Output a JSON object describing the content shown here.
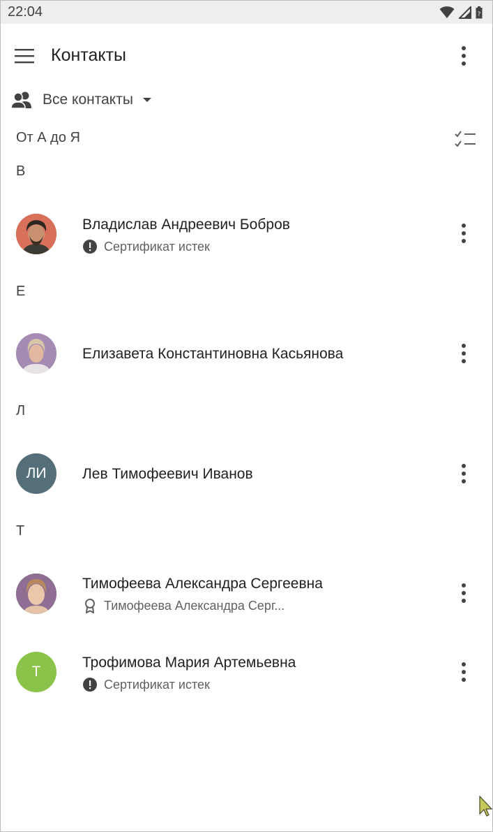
{
  "status_bar": {
    "time": "22:04",
    "icons": [
      "wifi-icon",
      "signal-icon",
      "battery-icon"
    ]
  },
  "app_bar": {
    "title": "Контакты",
    "menu_icon": "hamburger-icon",
    "overflow_icon": "more-vert-icon"
  },
  "filter": {
    "label": "Все контакты",
    "icon": "people-icon",
    "dropdown_icon": "arrow-drop-down-icon"
  },
  "sort": {
    "label": "От А до Я",
    "icon": "checklist-icon"
  },
  "sections": [
    {
      "letter": "В",
      "contacts": [
        {
          "name": "Владислав Андреевич Бобров",
          "subtitle": "Сертификат истек",
          "subtitle_icon": "alert-icon",
          "avatar": "photo",
          "avatar_bg": "#d9705a"
        }
      ]
    },
    {
      "letter": "Е",
      "contacts": [
        {
          "name": "Елизавета Константиновна Касьянова",
          "subtitle": "",
          "avatar": "photo",
          "avatar_bg": "#a58bb3"
        }
      ]
    },
    {
      "letter": "Л",
      "contacts": [
        {
          "name": "Лев Тимофеевич Иванов",
          "subtitle": "",
          "avatar": "initials",
          "initials": "ЛИ",
          "avatar_bg": "#546e7a"
        }
      ]
    },
    {
      "letter": "Т",
      "contacts": [
        {
          "name": "Тимофеева Александра Сергеевна",
          "subtitle": "Тимофеева Александра Серг...",
          "subtitle_icon": "certificate-icon",
          "avatar": "photo",
          "avatar_bg": "#8e6f93"
        },
        {
          "name": "Трофимова Мария Артемьевна",
          "subtitle": "Сертификат истек",
          "subtitle_icon": "alert-icon",
          "avatar": "initials",
          "initials": "Т",
          "avatar_bg": "#8bc34a"
        }
      ]
    }
  ],
  "colors": {
    "text_primary": "#212121",
    "text_secondary": "#616161",
    "status_bar_bg": "#eeeeee",
    "icon": "#424242"
  }
}
